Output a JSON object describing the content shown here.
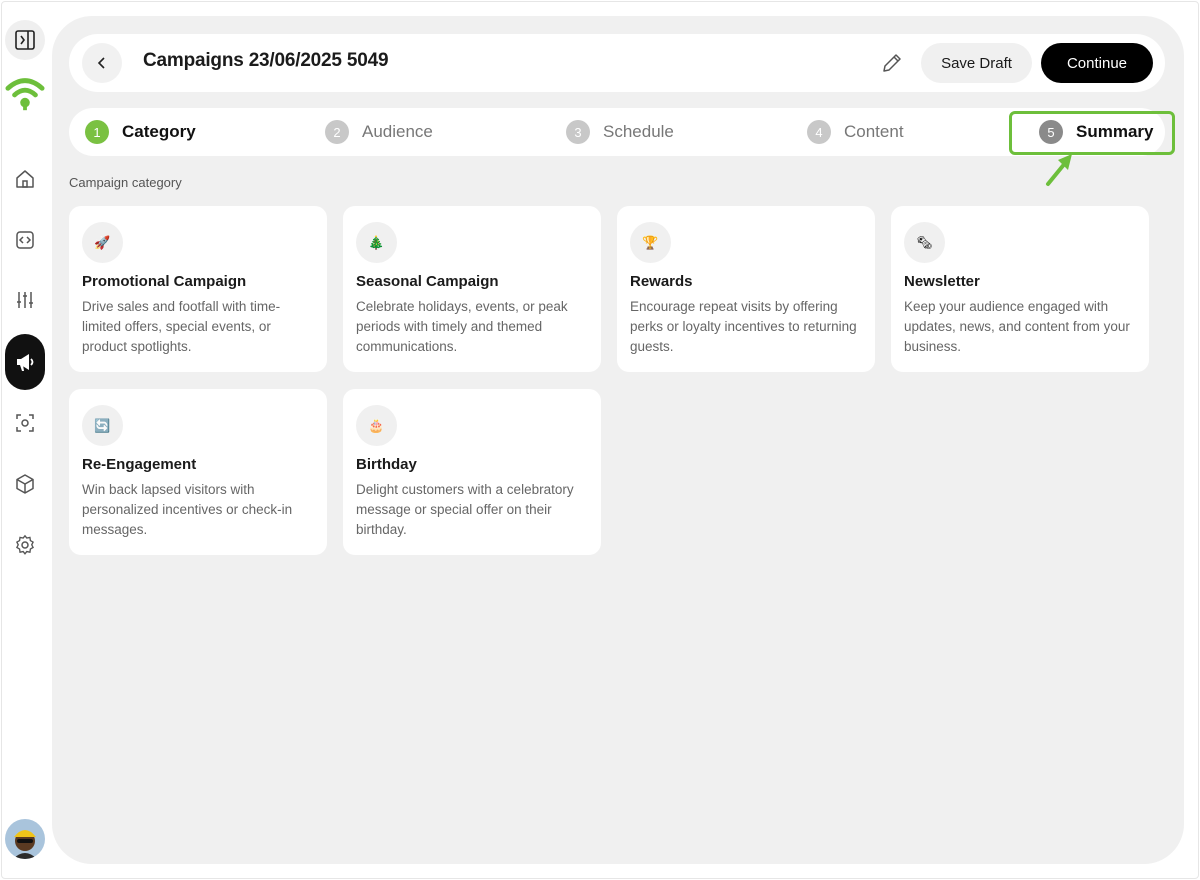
{
  "header": {
    "title": "Campaigns 23/06/2025 5049",
    "save_label": "Save Draft",
    "continue_label": "Continue"
  },
  "steps": [
    {
      "num": "1",
      "label": "Category"
    },
    {
      "num": "2",
      "label": "Audience"
    },
    {
      "num": "3",
      "label": "Schedule"
    },
    {
      "num": "4",
      "label": "Content"
    },
    {
      "num": "5",
      "label": "Summary"
    }
  ],
  "section_label": "Campaign category",
  "cards": [
    {
      "icon": "🚀",
      "icon_name": "rocket-icon",
      "title": "Promotional Campaign",
      "desc": "Drive sales and footfall with time-limited offers, special events, or product spotlights."
    },
    {
      "icon": "🎄",
      "icon_name": "tree-icon",
      "title": "Seasonal Campaign",
      "desc": "Celebrate holidays, events, or peak periods with timely and themed communications."
    },
    {
      "icon": "🏆",
      "icon_name": "trophy-icon",
      "title": "Rewards",
      "desc": "Encourage repeat visits by offering perks or loyalty incentives to returning guests."
    },
    {
      "icon": "🗞",
      "icon_name": "newspaper-icon",
      "title": "Newsletter",
      "desc": "Keep your audience engaged with updates, news, and content from your business."
    },
    {
      "icon": "🔄",
      "icon_name": "refresh-icon",
      "title": "Re-Engagement",
      "desc": "Win back lapsed visitors with personalized incentives or check-in messages."
    },
    {
      "icon": "🎂",
      "icon_name": "cake-icon",
      "title": "Birthday",
      "desc": "Delight customers with a celebratory message or special offer on their birthday."
    }
  ],
  "colors": {
    "accent": "#7ac142",
    "highlight": "#6dbf3b",
    "panel": "#f0f0f0"
  }
}
